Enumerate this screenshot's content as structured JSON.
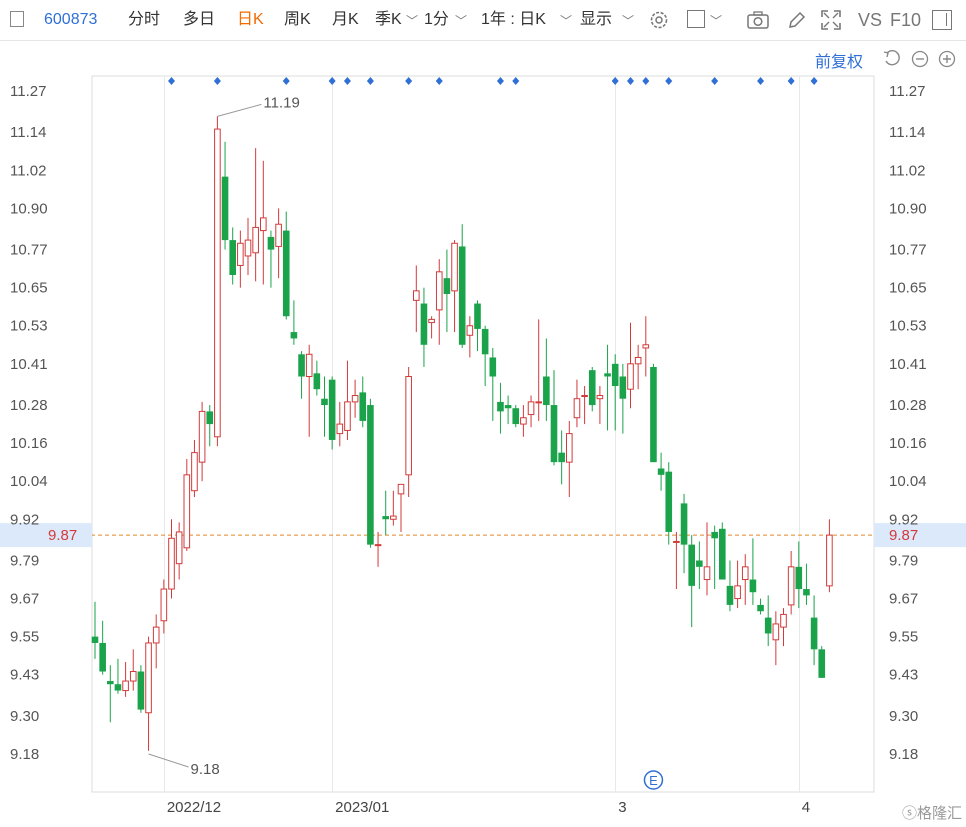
{
  "toolbar": {
    "code": "600873",
    "tab_intraday": "分时",
    "tab_multiday": "多日",
    "tab_daily": "日K",
    "tab_weekly": "周K",
    "tab_monthly": "月K",
    "tab_quarterly": "季K",
    "tab_minute": "1分",
    "period": "1年 : 日K",
    "display": "显示",
    "vs_label": "VS",
    "f10_label": "F10",
    "adjust_label": "前复权"
  },
  "colors": {
    "up": "#d23a3a",
    "down": "#1aa34a",
    "accent": "#2f6fd6",
    "active_tab": "#f26b00",
    "last_price_line": "#e0862a"
  },
  "chart_data": {
    "type": "candlestick",
    "title": "",
    "ylim": [
      9.12,
      11.32
    ],
    "y_ticks": [
      "11.27",
      "11.14",
      "11.02",
      "10.90",
      "10.77",
      "10.65",
      "10.53",
      "10.41",
      "10.28",
      "10.16",
      "10.04",
      "9.92",
      "9.79",
      "9.67",
      "9.55",
      "9.43",
      "9.30",
      "9.18"
    ],
    "x_labels": [
      {
        "label": "2022/12",
        "index": 9
      },
      {
        "label": "2023/01",
        "index": 31
      },
      {
        "label": "3",
        "index": 68
      },
      {
        "label": "4",
        "index": 92
      }
    ],
    "max_label": {
      "value": "11.19",
      "index": 16
    },
    "min_label": {
      "value": "9.18",
      "index": 7
    },
    "last_price": "9.87",
    "event_marker": "E",
    "event_index": 73,
    "top_markers": [
      10,
      16,
      25,
      31,
      33,
      36,
      41,
      45,
      53,
      55,
      68,
      70,
      72,
      75,
      81,
      87,
      91,
      94
    ],
    "ohlc": [
      [
        9.55,
        9.66,
        9.48,
        9.53
      ],
      [
        9.53,
        9.6,
        9.43,
        9.44
      ],
      [
        9.41,
        9.46,
        9.28,
        9.4
      ],
      [
        9.4,
        9.48,
        9.37,
        9.38
      ],
      [
        9.38,
        9.47,
        9.36,
        9.41
      ],
      [
        9.41,
        9.51,
        9.38,
        9.44
      ],
      [
        9.44,
        9.46,
        9.31,
        9.32
      ],
      [
        9.31,
        9.55,
        9.19,
        9.53
      ],
      [
        9.53,
        9.62,
        9.45,
        9.58
      ],
      [
        9.6,
        9.73,
        9.56,
        9.7
      ],
      [
        9.7,
        9.92,
        9.67,
        9.86
      ],
      [
        9.78,
        9.91,
        9.73,
        9.88
      ],
      [
        9.83,
        10.11,
        9.82,
        10.06
      ],
      [
        10.01,
        10.17,
        9.99,
        10.13
      ],
      [
        10.1,
        10.29,
        10.04,
        10.26
      ],
      [
        10.26,
        10.28,
        10.15,
        10.22
      ],
      [
        10.18,
        11.19,
        10.15,
        11.15
      ],
      [
        11.0,
        11.11,
        10.77,
        10.8
      ],
      [
        10.8,
        10.84,
        10.66,
        10.69
      ],
      [
        10.72,
        10.83,
        10.65,
        10.79
      ],
      [
        10.75,
        10.87,
        10.69,
        10.8
      ],
      [
        10.76,
        11.09,
        10.67,
        10.84
      ],
      [
        10.83,
        11.05,
        10.66,
        10.87
      ],
      [
        10.81,
        10.83,
        10.65,
        10.77
      ],
      [
        10.78,
        10.9,
        10.68,
        10.85
      ],
      [
        10.83,
        10.89,
        10.55,
        10.56
      ],
      [
        10.51,
        10.61,
        10.47,
        10.49
      ],
      [
        10.44,
        10.45,
        10.3,
        10.37
      ],
      [
        10.37,
        10.47,
        10.18,
        10.44
      ],
      [
        10.38,
        10.42,
        10.31,
        10.33
      ],
      [
        10.3,
        10.37,
        10.18,
        10.28
      ],
      [
        10.36,
        10.37,
        10.14,
        10.17
      ],
      [
        10.19,
        10.29,
        10.15,
        10.22
      ],
      [
        10.2,
        10.42,
        10.17,
        10.29
      ],
      [
        10.29,
        10.36,
        10.24,
        10.31
      ],
      [
        10.32,
        10.37,
        10.21,
        10.23
      ],
      [
        10.28,
        10.3,
        9.83,
        9.84
      ],
      [
        9.84,
        9.88,
        9.77,
        9.84
      ],
      [
        9.93,
        10.01,
        9.87,
        9.92
      ],
      [
        9.92,
        10.01,
        9.9,
        9.93
      ],
      [
        10.0,
        10.03,
        9.88,
        10.03
      ],
      [
        10.06,
        10.4,
        9.99,
        10.37
      ],
      [
        10.61,
        10.72,
        10.51,
        10.64
      ],
      [
        10.6,
        10.65,
        10.4,
        10.47
      ],
      [
        10.54,
        10.56,
        10.49,
        10.55
      ],
      [
        10.58,
        10.74,
        10.47,
        10.7
      ],
      [
        10.68,
        10.77,
        10.51,
        10.63
      ],
      [
        10.64,
        10.8,
        10.51,
        10.79
      ],
      [
        10.78,
        10.85,
        10.46,
        10.47
      ],
      [
        10.5,
        10.56,
        10.43,
        10.53
      ],
      [
        10.6,
        10.61,
        10.45,
        10.52
      ],
      [
        10.52,
        10.53,
        10.34,
        10.44
      ],
      [
        10.43,
        10.46,
        10.23,
        10.37
      ],
      [
        10.29,
        10.35,
        10.19,
        10.26
      ],
      [
        10.28,
        10.31,
        10.22,
        10.27
      ],
      [
        10.27,
        10.28,
        10.21,
        10.22
      ],
      [
        10.22,
        10.28,
        10.18,
        10.24
      ],
      [
        10.25,
        10.31,
        10.21,
        10.29
      ],
      [
        10.29,
        10.55,
        10.23,
        10.29
      ],
      [
        10.37,
        10.49,
        10.23,
        10.28
      ],
      [
        10.28,
        10.39,
        10.09,
        10.1
      ],
      [
        10.13,
        10.2,
        10.03,
        10.1
      ],
      [
        10.1,
        10.23,
        9.99,
        10.19
      ],
      [
        10.24,
        10.36,
        10.21,
        10.3
      ],
      [
        10.31,
        10.34,
        10.22,
        10.31
      ],
      [
        10.39,
        10.4,
        10.26,
        10.28
      ],
      [
        10.3,
        10.34,
        10.22,
        10.31
      ],
      [
        10.38,
        10.47,
        10.2,
        10.37
      ],
      [
        10.41,
        10.44,
        10.2,
        10.34
      ],
      [
        10.37,
        10.41,
        10.19,
        10.3
      ],
      [
        10.33,
        10.54,
        10.27,
        10.41
      ],
      [
        10.41,
        10.47,
        10.33,
        10.43
      ],
      [
        10.46,
        10.56,
        10.37,
        10.47
      ],
      [
        10.4,
        10.41,
        10.1,
        10.1
      ],
      [
        10.08,
        10.13,
        10.01,
        10.06
      ],
      [
        10.07,
        10.1,
        9.84,
        9.88
      ],
      [
        9.85,
        9.88,
        9.7,
        9.85
      ],
      [
        9.97,
        10.0,
        9.75,
        9.84
      ],
      [
        9.84,
        9.87,
        9.58,
        9.71
      ],
      [
        9.79,
        9.85,
        9.7,
        9.77
      ],
      [
        9.73,
        9.91,
        9.68,
        9.77
      ],
      [
        9.88,
        9.9,
        9.7,
        9.86
      ],
      [
        9.89,
        9.91,
        9.74,
        9.73
      ],
      [
        9.71,
        9.79,
        9.63,
        9.65
      ],
      [
        9.67,
        9.79,
        9.64,
        9.71
      ],
      [
        9.73,
        9.81,
        9.65,
        9.77
      ],
      [
        9.73,
        9.86,
        9.65,
        9.69
      ],
      [
        9.65,
        9.67,
        9.62,
        9.63
      ],
      [
        9.61,
        9.68,
        9.52,
        9.56
      ],
      [
        9.54,
        9.63,
        9.46,
        9.59
      ],
      [
        9.58,
        9.64,
        9.52,
        9.62
      ],
      [
        9.65,
        9.82,
        9.62,
        9.77
      ],
      [
        9.77,
        9.85,
        9.64,
        9.7
      ],
      [
        9.7,
        9.78,
        9.65,
        9.68
      ],
      [
        9.61,
        9.68,
        9.46,
        9.51
      ],
      [
        9.51,
        9.52,
        9.42,
        9.42
      ],
      [
        9.71,
        9.92,
        9.69,
        9.87
      ]
    ]
  }
}
